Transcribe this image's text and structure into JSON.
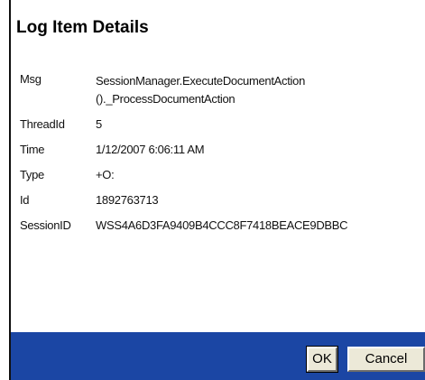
{
  "dialog": {
    "title": "Log Item Details"
  },
  "details": {
    "msg": {
      "label": "Msg",
      "value_line1": "SessionManager.ExecuteDocumentAction",
      "value_line2": "()._ProcessDocumentAction"
    },
    "thread_id": {
      "label": "ThreadId",
      "value": "5"
    },
    "time": {
      "label": "Time",
      "value": "1/12/2007 6:06:11 AM"
    },
    "type": {
      "label": "Type",
      "value": "+O:"
    },
    "id": {
      "label": "Id",
      "value": "1892763713"
    },
    "session_id": {
      "label": "SessionID",
      "value": "WSS4A6D3FA9409B4CCC8F7418BEACE9DBBC"
    }
  },
  "buttons": {
    "ok_label": "OK",
    "cancel_label": "Cancel"
  },
  "colors": {
    "button_bar": "#1b46a4",
    "button_face": "#ece9d8"
  }
}
